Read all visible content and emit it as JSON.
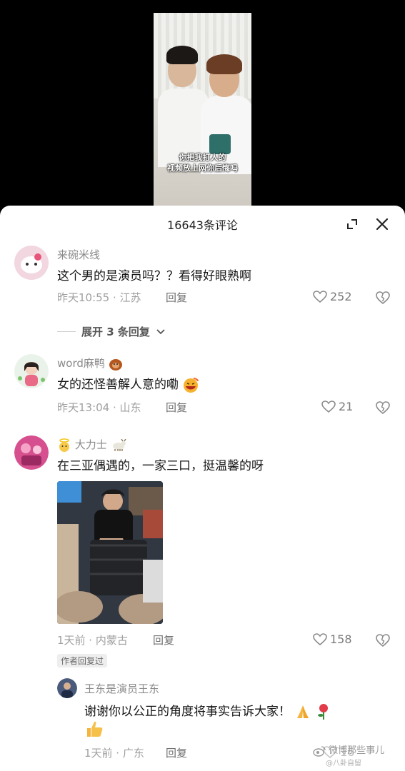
{
  "video": {
    "subtitle_line1": "你把我打人的",
    "subtitle_line2": "视频放上网你后悔吗"
  },
  "sheet": {
    "title": "16643条评论"
  },
  "comments": [
    {
      "username": "来碗米线",
      "text": "这个男的是演员吗？？看得好眼熟啊",
      "meta": "昨天10:55 · 江苏",
      "reply_label": "回复",
      "likes": "252",
      "expand_label": "展开 3 条回复"
    },
    {
      "username": "word麻鸭",
      "text": "女的还怪善解人意的嘞",
      "meta": "昨天13:04 · 山东",
      "reply_label": "回复",
      "likes": "21"
    },
    {
      "username": "大力士",
      "text": "在三亚偶遇的，一家三口，挺温馨的呀",
      "meta": "1天前 · 内蒙古",
      "reply_label": "回复",
      "likes": "158",
      "author_tag": "作者回复过"
    }
  ],
  "sub_reply": {
    "username": "王东是演员王东",
    "text_line1": "谢谢你以公正的角度将事实告诉大家！",
    "meta": "1天前 · 广东",
    "reply_label": "回复",
    "likes": "16"
  },
  "watermark": {
    "line1": "微博那些事儿",
    "line2": "@八卦自留"
  },
  "colors": {
    "heart": "#8a8a8a",
    "meta": "#a0a0a0",
    "username": "#8a8a8a"
  }
}
